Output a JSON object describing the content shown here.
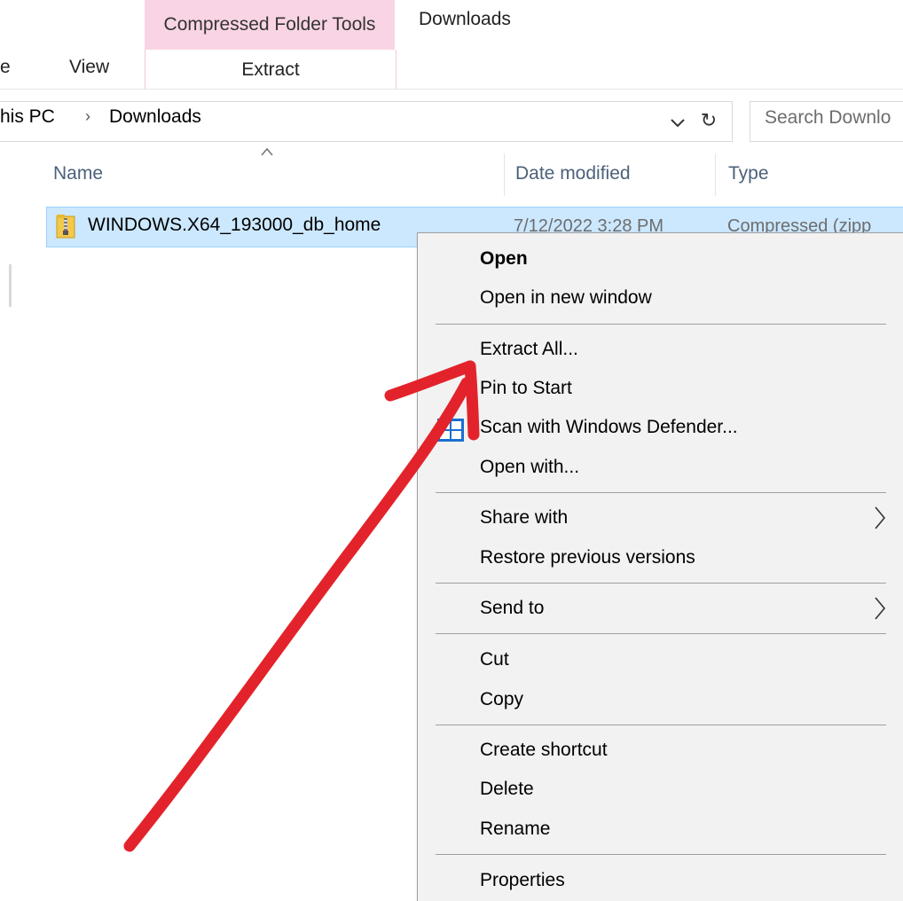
{
  "ribbon": {
    "context_tab_group": "Compressed Folder Tools",
    "context_tab": "Extract",
    "title": "Downloads",
    "tab_partial": "e",
    "tab_view": "View"
  },
  "address": {
    "crumb_root": "his PC",
    "separator": "›",
    "crumb_current": "Downloads",
    "refresh_glyph": "↻"
  },
  "search": {
    "placeholder": "Search Downlo"
  },
  "columns": {
    "name": "Name",
    "date": "Date modified",
    "type": "Type"
  },
  "file": {
    "name": "WINDOWS.X64_193000_db_home",
    "date_modified": "7/12/2022 3:28 PM",
    "type": "Compressed (zipp",
    "icon": "zip-folder-icon"
  },
  "context_menu": {
    "open": "Open",
    "open_new_window": "Open in new window",
    "extract_all": "Extract All...",
    "pin_to_start": "Pin to Start",
    "scan_defender": "Scan with Windows Defender...",
    "open_with": "Open with...",
    "share_with": "Share with",
    "restore_versions": "Restore previous versions",
    "send_to": "Send to",
    "cut": "Cut",
    "copy": "Copy",
    "create_shortcut": "Create shortcut",
    "delete": "Delete",
    "rename": "Rename",
    "properties": "Properties"
  },
  "colors": {
    "selection": "#cce8ff",
    "context_tab": "#f9d4e4",
    "annotation_arrow": "#e3232b",
    "menu_bg": "#f2f2f2"
  }
}
